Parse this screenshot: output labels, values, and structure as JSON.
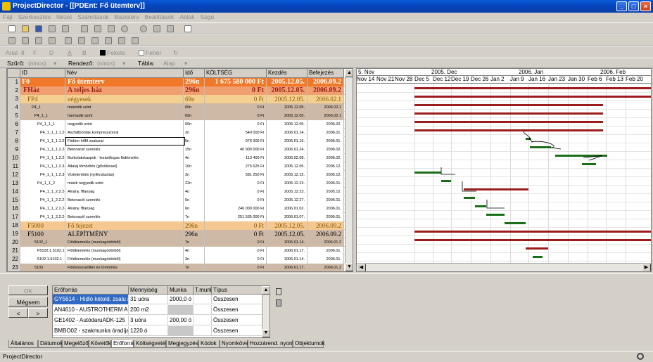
{
  "window": {
    "title": "ProjectDirector - [[PDEnt: Fő ütemterv]]"
  },
  "menu": [
    "Fájl",
    "Szerkesztés",
    "Nézet",
    "Számítások",
    "Bázisterv",
    "Beállítások",
    "Ablak",
    "Súgó"
  ],
  "format_bar": {
    "font": "Arial",
    "size": "8",
    "bold": "F",
    "italic": "D",
    "underline": "A",
    "fg_prefix": "B",
    "fg_color": "Fekete",
    "bg_color": "Fehér"
  },
  "filter_bar": {
    "filter_label": "Szűrő:",
    "filter_value": "(nincs)",
    "sort_label": "Rendező:",
    "sort_value": "(nincs)",
    "table_label": "Tábla:",
    "table_value": "Alap"
  },
  "grid": {
    "columns": [
      "ID",
      "Név",
      "Idő",
      "KÖLTSÉG",
      "Kezdés",
      "Befejezés"
    ],
    "rows": [
      {
        "n": "1",
        "id": "F0",
        "name": "Fő ütemterv",
        "dur": "296n",
        "cost": "1 675 580 000 Ft",
        "start": "2005.12.05.",
        "end": "2006.09.2"
      },
      {
        "n": "2",
        "id": "FHáz",
        "name": "A teljes ház",
        "dur": "296n",
        "cost": "0 Ft",
        "start": "2005.12.05.",
        "end": "2006.09.2"
      },
      {
        "n": "3",
        "id": "FP4",
        "name": "négyesek",
        "dur": "69n",
        "cost": "0 Ft",
        "start": "2005.12.05.",
        "end": "2006.02.1"
      },
      {
        "n": "4",
        "id": "P4_1",
        "name": "második szint",
        "dur": "69n",
        "cost": "0 Ft",
        "start": "2005.12.05.",
        "end": "2006.02.1"
      },
      {
        "n": "5",
        "id": "P4_1_1",
        "name": "harmadik szint",
        "dur": "69n",
        "cost": "0 Ft",
        "start": "2005.12.05.",
        "end": "2006.02.1"
      },
      {
        "n": "6",
        "id": "P4_1_1_1",
        "name": "negyedik szint",
        "dur": "69n",
        "cost": "0 Ft",
        "start": "2005.12.05.",
        "end": "2006.02."
      },
      {
        "n": "7",
        "id": "P4_1_1_1.1.2-63",
        "name": "Aszfaltbontás kompresszorral",
        "dur": "2n",
        "cost": "540 000 Ft",
        "start": "2006.01.14.",
        "end": "2006.01."
      },
      {
        "n": "8",
        "id": "P4_1_1_1.1.2-10",
        "name": "Födém hőfő zsaluzat",
        "dur": "5n",
        "cost": "976 000 Ft",
        "start": "2006.01.16.",
        "end": "2006.01."
      },
      {
        "n": "9",
        "id": "P4_1_1_1.2.2-4",
        "name": "Betonacél szerelés",
        "dur": "15n",
        "cost": "40 900 000 Ft",
        "start": "2006.01.24.",
        "end": "2006.02."
      },
      {
        "n": "10",
        "id": "P4_1_1_1.2.2-21",
        "name": "Burkolatokaspok - lezárófogas födémelés",
        "dur": "4n",
        "cost": "113 400 Ft",
        "start": "2006.02.08.",
        "end": "2006.02."
      },
      {
        "n": "11",
        "id": "P4_1_1_1.2.3-21",
        "name": "Altalaj tömörítés (gőzöléssel)",
        "dur": "10n",
        "cost": "275 625 Ft",
        "start": "2005.12.05.",
        "end": "2005.12."
      },
      {
        "n": "12",
        "id": "P4_1_1_1.2.3-14",
        "name": "Vízteleníttés (nyíltvíztartás)",
        "dur": "3n",
        "cost": "581 250 Ft",
        "start": "2005.12.15.",
        "end": "2005.12."
      },
      {
        "n": "13",
        "id": "P4_1_1_2",
        "name": "másik negyedik szint",
        "dur": "22n",
        "cost": "0 Ft",
        "start": "2005.12.23.",
        "end": "2006.01."
      },
      {
        "n": "14",
        "id": "P4_1_1_2.2.2-66",
        "name": "Alvány, fflanyag",
        "dur": "4n",
        "cost": "0 Ft",
        "start": "2005.12.23.",
        "end": "2005.12."
      },
      {
        "n": "15",
        "id": "P4_1_1_2.2.2-4",
        "name": "Betonacél szerelés",
        "dur": "5n",
        "cost": "0 Ft",
        "start": "2005.12.27.",
        "end": "2006.01."
      },
      {
        "n": "16",
        "id": "P4_1_1_2.2.2-66",
        "name": "Alvány, fflanyag",
        "dur": "6n",
        "cost": "246 000 000 Ft",
        "start": "2006.01.02.",
        "end": "2006.01."
      },
      {
        "n": "17",
        "id": "P4_1_1_2.2.2-4",
        "name": "Betonacél szerelés",
        "dur": "7n",
        "cost": "251 535 000 Ft",
        "start": "2006.01.07.",
        "end": "2006.01."
      },
      {
        "n": "18",
        "id": "F5000",
        "name": "Fő fejezet",
        "dur": "296n",
        "cost": "0 Ft",
        "start": "2005.12.05.",
        "end": "2006.09.2"
      },
      {
        "n": "19",
        "id": "F5100",
        "name": "ALÉPÍTMÉNY",
        "dur": "296n",
        "cost": "0 Ft",
        "start": "2005.12.05.",
        "end": "2006.09.2"
      },
      {
        "n": "20",
        "id": "5102_1",
        "name": "Földkiemelés (munkagödörből)",
        "dur": "7n",
        "cost": "0 Ft",
        "start": "2006.01.14.",
        "end": "2006.01.2"
      },
      {
        "n": "21",
        "id": "F5102.1.5102.1",
        "name": "Földkiemelés (munkagödörből)",
        "dur": "4n",
        "cost": "0 Ft",
        "start": "2006.01.17.",
        "end": "2006.01."
      },
      {
        "n": "22",
        "id": "5102.1.5102.1",
        "name": "Földkiemelés (munkagödörből)",
        "dur": "3n",
        "cost": "0 Ft",
        "start": "2006.01.14.",
        "end": "2006.01."
      },
      {
        "n": "23",
        "id": "5103",
        "name": "Földvisszatöltés és tömörítés",
        "dur": "7n",
        "cost": "0 Ft",
        "start": "2006.01.17.",
        "end": "2006.01.2"
      }
    ]
  },
  "gantt": {
    "months": [
      "5. Nov",
      "2005. Dec",
      "2006. Jan",
      "2006. Feb"
    ],
    "weeks": [
      "Nov 14",
      "Nov 21",
      "Nov 28",
      "Dec 5",
      "Dec 12",
      "Dec 19",
      "Dec 26",
      "Jan 2",
      "Jan 9",
      "Jan 16",
      "Jan 23",
      "Jan 30",
      "Feb 6",
      "Feb 13",
      "Feb 20"
    ],
    "summary_color": "#9c1c1c",
    "task_color": "#1a6e1a"
  },
  "resource_panel": {
    "buttons": {
      "ok": "OK",
      "cancel": "Mégsem",
      "prev": "<",
      "next": ">"
    },
    "columns": [
      "Erőforrás",
      "Mennyiség",
      "Munka",
      "T.munk",
      "Típus"
    ],
    "rows": [
      {
        "res": "GY5614 - Hídló kétold. zsalu m",
        "qty": "31 uóra",
        "work": "2000,0 ó",
        "tm": "",
        "type": "Összesen"
      },
      {
        "res": "AN4610 - AUSTROTHERM A1",
        "qty": "200 m2",
        "work": "",
        "tm": "",
        "type": "Összesen"
      },
      {
        "res": "GE1402 - AutódaruADK-125",
        "qty": "3 uóra",
        "work": "200,00 ó",
        "tm": "",
        "type": "Összesen"
      },
      {
        "res": "BMBO02 - szakmunka óradíja",
        "qty": "1220 ó",
        "work": "",
        "tm": "",
        "type": "Összesen"
      }
    ]
  },
  "tabs": [
    "Általános",
    "Dátumok",
    "Megelőzők",
    "Követők",
    "Erőforrások",
    "Költségvetés",
    "Megjegyzés",
    "Kódok",
    "Nyomkövetés",
    "Hozzárend. nyomk.",
    "Objektumok"
  ],
  "status": {
    "text": "ProjectDirector"
  }
}
